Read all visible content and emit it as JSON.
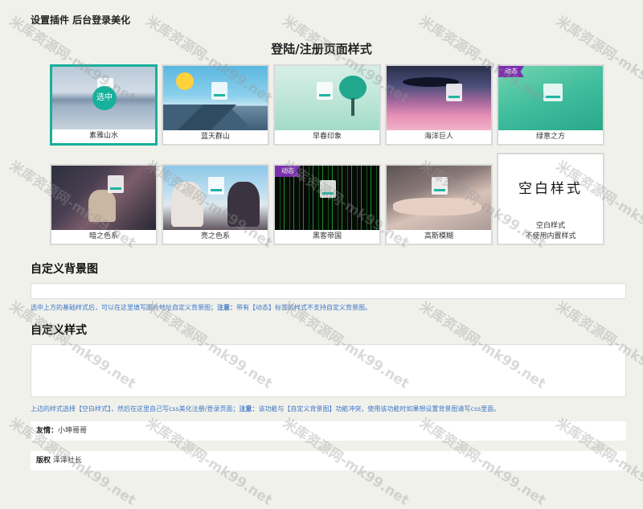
{
  "page": {
    "title": "设置插件 后台登录美化"
  },
  "login_styles": {
    "heading": "登陆/注册页面样式",
    "selected_label": "选中",
    "dynamic_badge": "动态",
    "items": [
      {
        "label": "素雅山水"
      },
      {
        "label": "蓝天群山"
      },
      {
        "label": "早春印象"
      },
      {
        "label": "海洋巨人"
      },
      {
        "label": "绿意之方"
      },
      {
        "label": "暗之色系"
      },
      {
        "label": "亮之色系"
      },
      {
        "label": "黑客帝国"
      },
      {
        "label": "高斯模糊"
      },
      {
        "label": "空白样式",
        "art_text": "空白样式",
        "sub_label": "不使用内置样式"
      }
    ]
  },
  "custom_background": {
    "heading": "自定义背景图",
    "value": "",
    "hint_prefix": "选中上方的基础样式后，可以在这里填写图片地址自定义背景图；",
    "hint_bold": "注意：",
    "hint_suffix": "带有【动态】标签的样式不支持自定义背景图。"
  },
  "custom_style": {
    "heading": "自定义样式",
    "value": "",
    "hint_prefix": "上边的样式选择【空白样式】，然后在这里自己写css美化注册/登录页面；",
    "hint_bold": "注意：",
    "hint_suffix": "该功能与【自定义背景图】功能冲突，使用该功能时如果想设置背景图请写css里面。"
  },
  "footer": {
    "friend_label": "友情：",
    "friend_value": "小坤哥哥",
    "copyright_label": "版权",
    "copyright_value": "泽泽社长"
  },
  "watermark": {
    "text": "米库资源网-mk99.net"
  }
}
